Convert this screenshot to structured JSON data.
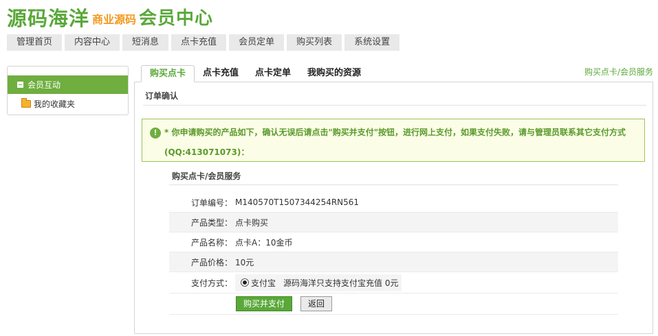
{
  "header": {
    "logo_main": "源码海洋",
    "logo_sub": "商业源码",
    "logo_center": "会员中心"
  },
  "topnav": {
    "items": [
      {
        "label": "管理首页"
      },
      {
        "label": "内容中心"
      },
      {
        "label": "短消息"
      },
      {
        "label": "点卡充值"
      },
      {
        "label": "会员定单"
      },
      {
        "label": "购买列表"
      },
      {
        "label": "系统设置"
      }
    ]
  },
  "sidebar": {
    "active_label": "会员互动",
    "items": [
      {
        "label": "我的收藏夹",
        "icon": "folder-icon"
      }
    ]
  },
  "tabs": {
    "items": [
      {
        "label": "购买点卡"
      },
      {
        "label": "点卡充值"
      },
      {
        "label": "点卡定单"
      },
      {
        "label": "我购买的资源"
      }
    ],
    "active_index": 0,
    "right_label": "购买点卡/会员服务"
  },
  "main": {
    "panel_title": "订单确认",
    "notice": "* 你申请购买的产品如下，确认无误后请点击\"购买并支付\"按钮，进行网上支付，如果支付失败，请与管理员联系其它支付方式(QQ:413071073)：",
    "section_title": "购买点卡/会员服务",
    "fields": {
      "order_no_label": "订单编号：",
      "order_no": "M140570T1507344254RN561",
      "product_type_label": "产品类型：",
      "product_type": "点卡购买",
      "product_name_label": "产品名称：",
      "product_name": "点卡A：10金币",
      "price_label": "产品价格：",
      "price": "10元",
      "payment_label": "支付方式：",
      "payment_option": "支付宝",
      "payment_note": "源码海洋只支持支付宝充值 0元"
    },
    "buttons": {
      "buy": "购买并支付",
      "back": "返回"
    }
  },
  "colors": {
    "accent_green": "#6fae3f",
    "logo_green": "#5aa83a",
    "logo_orange": "#f39a1e",
    "notice_bg": "#fbfde6"
  }
}
